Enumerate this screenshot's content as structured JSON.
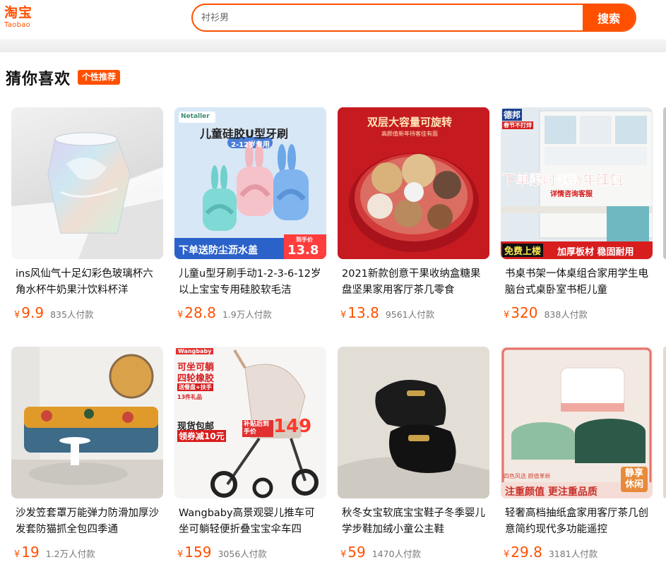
{
  "header": {
    "logo_cn": "淘宝",
    "logo_en": "Taobao",
    "search_placeholder": "衬衫男",
    "search_button": "搜索"
  },
  "section": {
    "title": "猜你喜欢",
    "badge": "个性推荐"
  },
  "currency": "¥",
  "products": [
    {
      "title": "ins风仙气十足幻彩色玻璃杯六角水杯牛奶果汁饮料杯洋",
      "price": "9.9",
      "sold": "835人付款"
    },
    {
      "title": "儿童u型牙刷手动1-2-3-6-12岁以上宝宝专用硅胶软毛洁",
      "price": "28.8",
      "sold": "1.9万人付款"
    },
    {
      "title": "2021新款创意干果收纳盒糖果盘坚果家用客厅茶几零食",
      "price": "13.8",
      "sold": "9561人付款"
    },
    {
      "title": "书桌书架一体桌组合家用学生电脑台式桌卧室书柜儿童",
      "price": "320",
      "sold": "838人付款"
    },
    {
      "title": "沙发笠套罩万能弹力防滑加厚沙发套防猫抓全包四季通",
      "price": "19",
      "sold": "1.2万人付款"
    },
    {
      "title": "Wangbaby高景观婴儿推车可坐可躺轻便折叠宝宝伞车四",
      "price": "159",
      "sold": "3056人付款"
    },
    {
      "title": "秋冬女宝软底宝宝鞋子冬季婴儿学步鞋加绒小童公主鞋",
      "price": "59",
      "sold": "1470人付款"
    },
    {
      "title": "轻奢高档抽纸盒家用客厅茶几创意简约现代多功能遥控",
      "price": "29.8",
      "sold": "3181人付款"
    }
  ],
  "image_text": {
    "p2_brand": "Netaller",
    "p2_headline": "儿童硅胶U型牙刷",
    "p2_age": "2-12岁专用",
    "p2_promo": "下单送防尘沥水盖",
    "p2_price_label": "到手价",
    "p2_price": "13.8",
    "p3_headline": "双层大容量可旋转",
    "p3_sub": "高颜值新年待客佳有面",
    "p4_brand": "德邦",
    "p4_tag": "春节不打烊",
    "p4_headline": "下单限时领新年红包",
    "p4_sub": "详情咨询客服",
    "p4_bottom1": "免费上楼",
    "p4_bottom2": "加厚板材 稳固耐用",
    "p6_brand": "Wangbaby",
    "p6_head1": "可坐可躺",
    "p6_head2": "四轮橡胶",
    "p6_tag1": "送餐盘+扶手",
    "p6_tag2": "13件礼品",
    "p6_promo1": "现货包邮",
    "p6_promo2": "领券减10元",
    "p6_price_label": "补贴后到手价",
    "p6_price": "149",
    "p8_tag": "四色风选 颜值革新",
    "p8_bottom": "注重颜值 更注重品质",
    "p8_corner": "静享休闲"
  }
}
